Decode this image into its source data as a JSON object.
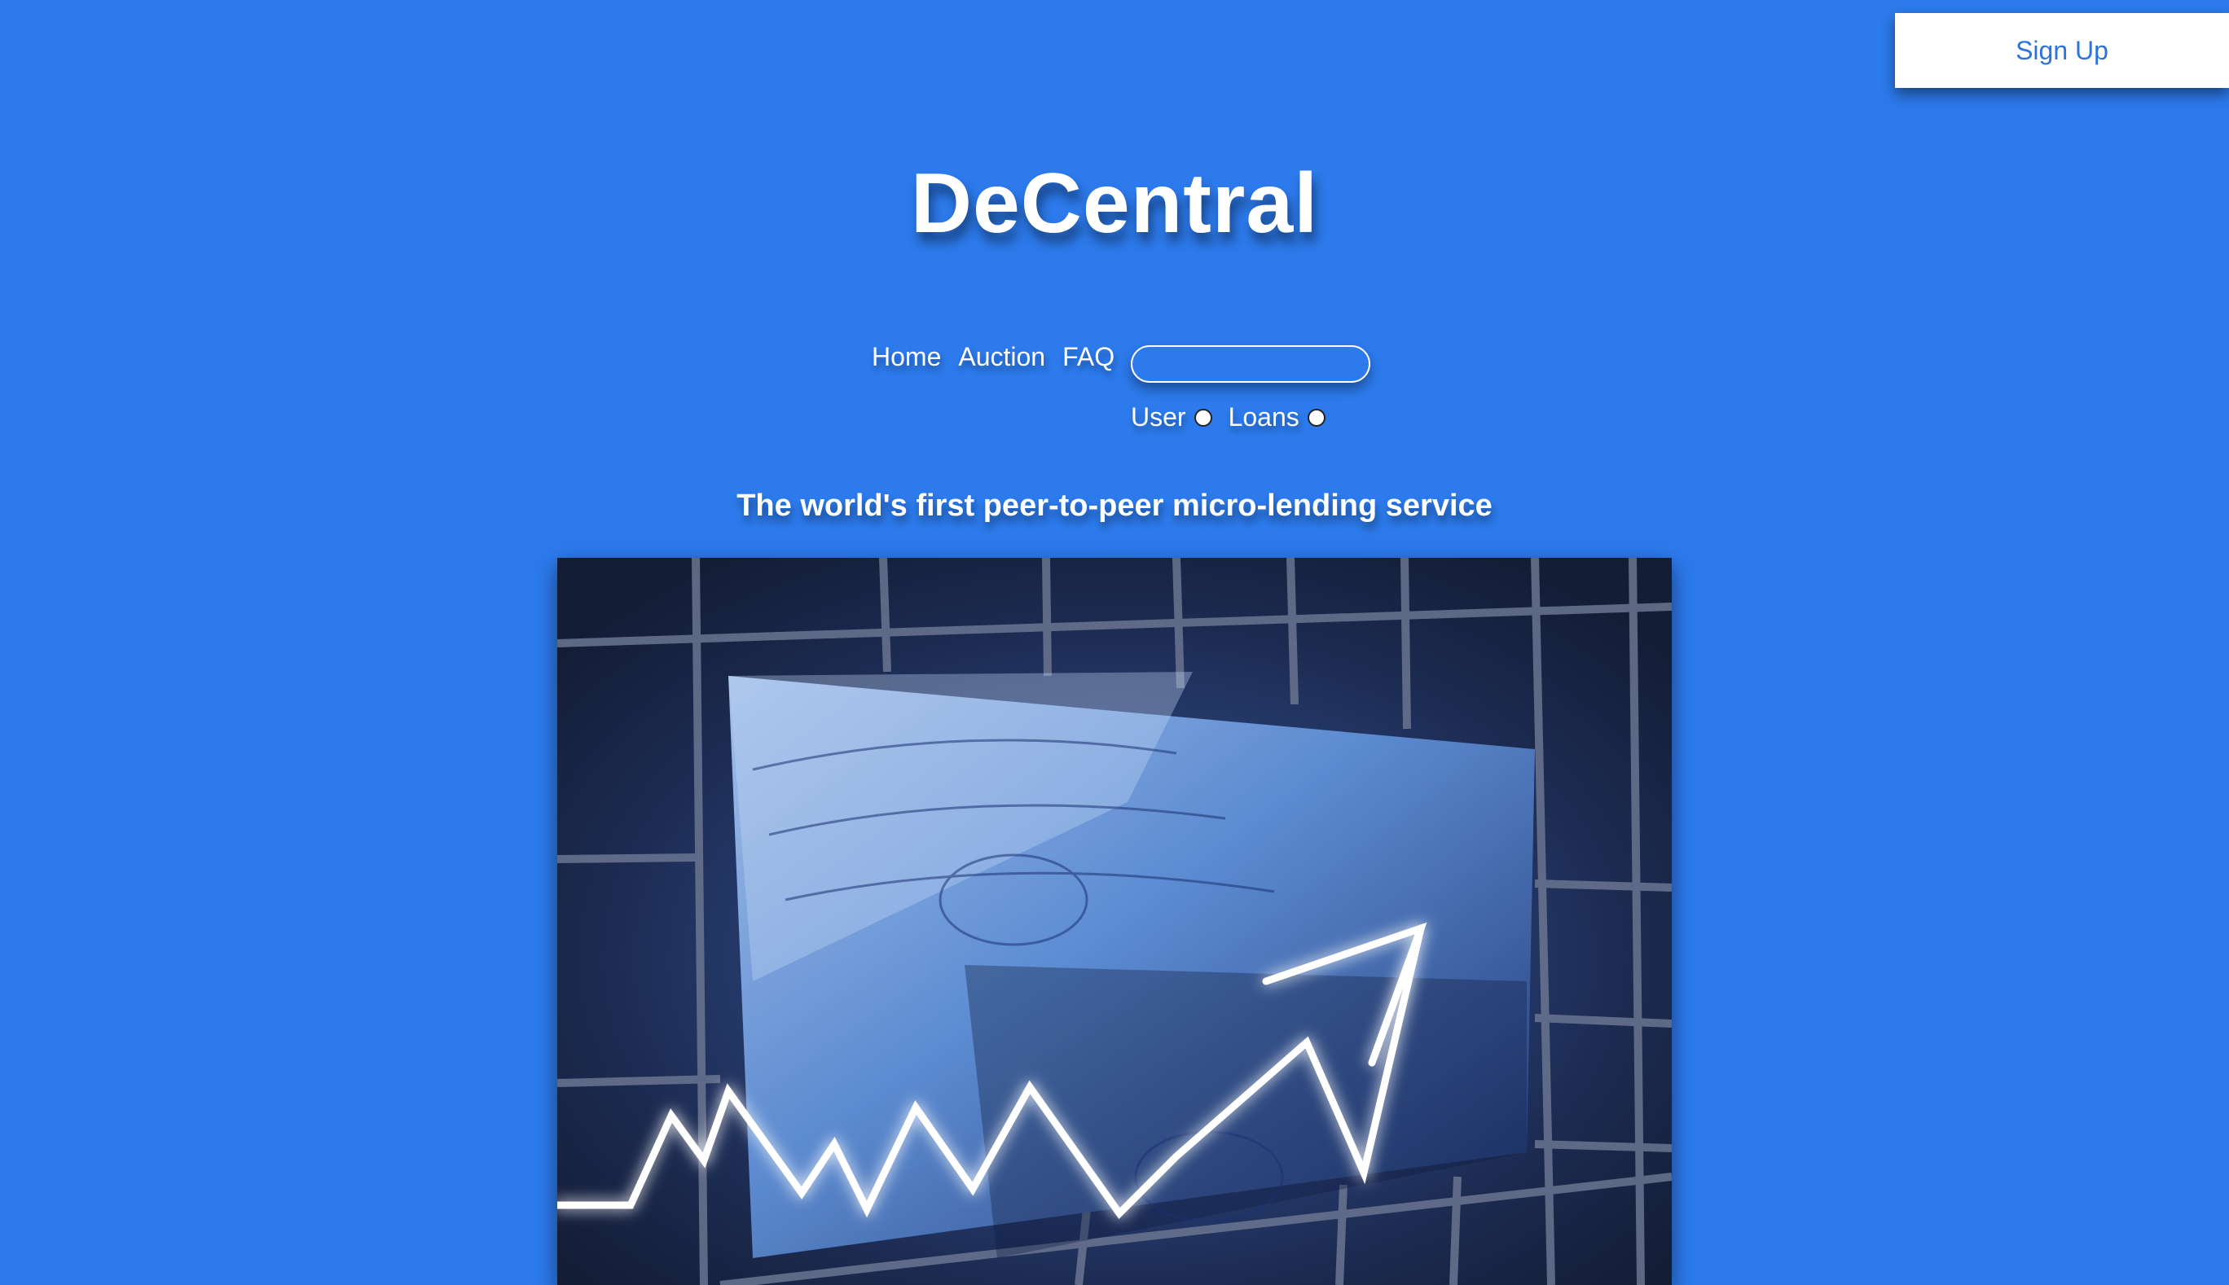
{
  "header": {
    "signup_label": "Sign Up"
  },
  "brand": {
    "title": "DeCentral"
  },
  "nav": {
    "items": [
      "Home",
      "Auction",
      "FAQ"
    ],
    "search_value": ""
  },
  "search_type": {
    "options": [
      "User",
      "Loans"
    ]
  },
  "main": {
    "tagline": "The world's first peer-to-peer micro-lending service",
    "hero_image": "stock-growth-arrow-over-dollar-bills"
  },
  "colors": {
    "background": "#2c7aec",
    "accent_text": "#2c73dd",
    "text": "#ffffff"
  }
}
